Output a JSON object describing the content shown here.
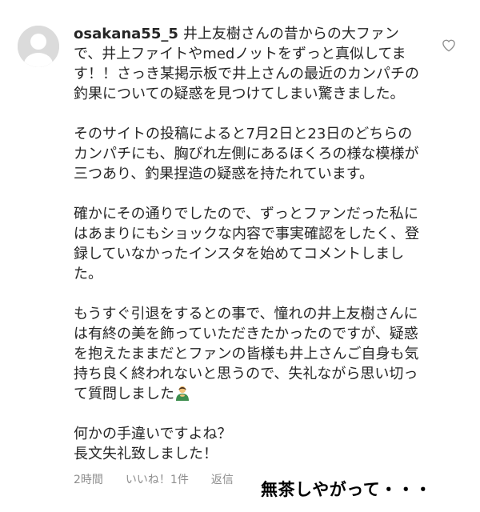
{
  "comment": {
    "username": "osakana55_5",
    "paragraphs": [
      "井上友樹さんの昔からの大ファンで、井上ファイトやmedノットをずっと真似してます！！さっき某掲示板で井上さんの最近のカンパチの釣果についての疑惑を見つけてしまい驚きました。",
      "そのサイトの投稿によると7月2日と23日のどちらのカンパチにも、胸びれ左側にあるほくろの様な模様が三つあり、釣果捏造の疑惑を持たれています。",
      "確かにその通りでしたので、ずっとファンだった私にはあまりにもショックな内容で事実確認をしたく、登録していなかったインスタを始めてコメントしました。",
      "もうすぐ引退をするとの事で、憧れの井上友樹さんには有終の美を飾っていただきたかったのですが、疑惑を抱えたままだとファンの皆様も井上さんご自身も気持ち良く終われないと思うので、失礼ながら思い切って質問しました",
      "何かの手違いですよね？",
      "長文失礼致しました！"
    ],
    "emoji": "person-bowing-emoji",
    "time": "2時間",
    "likes": "いいね！1件",
    "reply": "返信"
  },
  "overlay_caption": "無茶しやがって・・・",
  "colors": {
    "text": "#262626",
    "meta": "#8e8e8e",
    "avatar": "#dbdbdb",
    "caption": "#000000"
  }
}
